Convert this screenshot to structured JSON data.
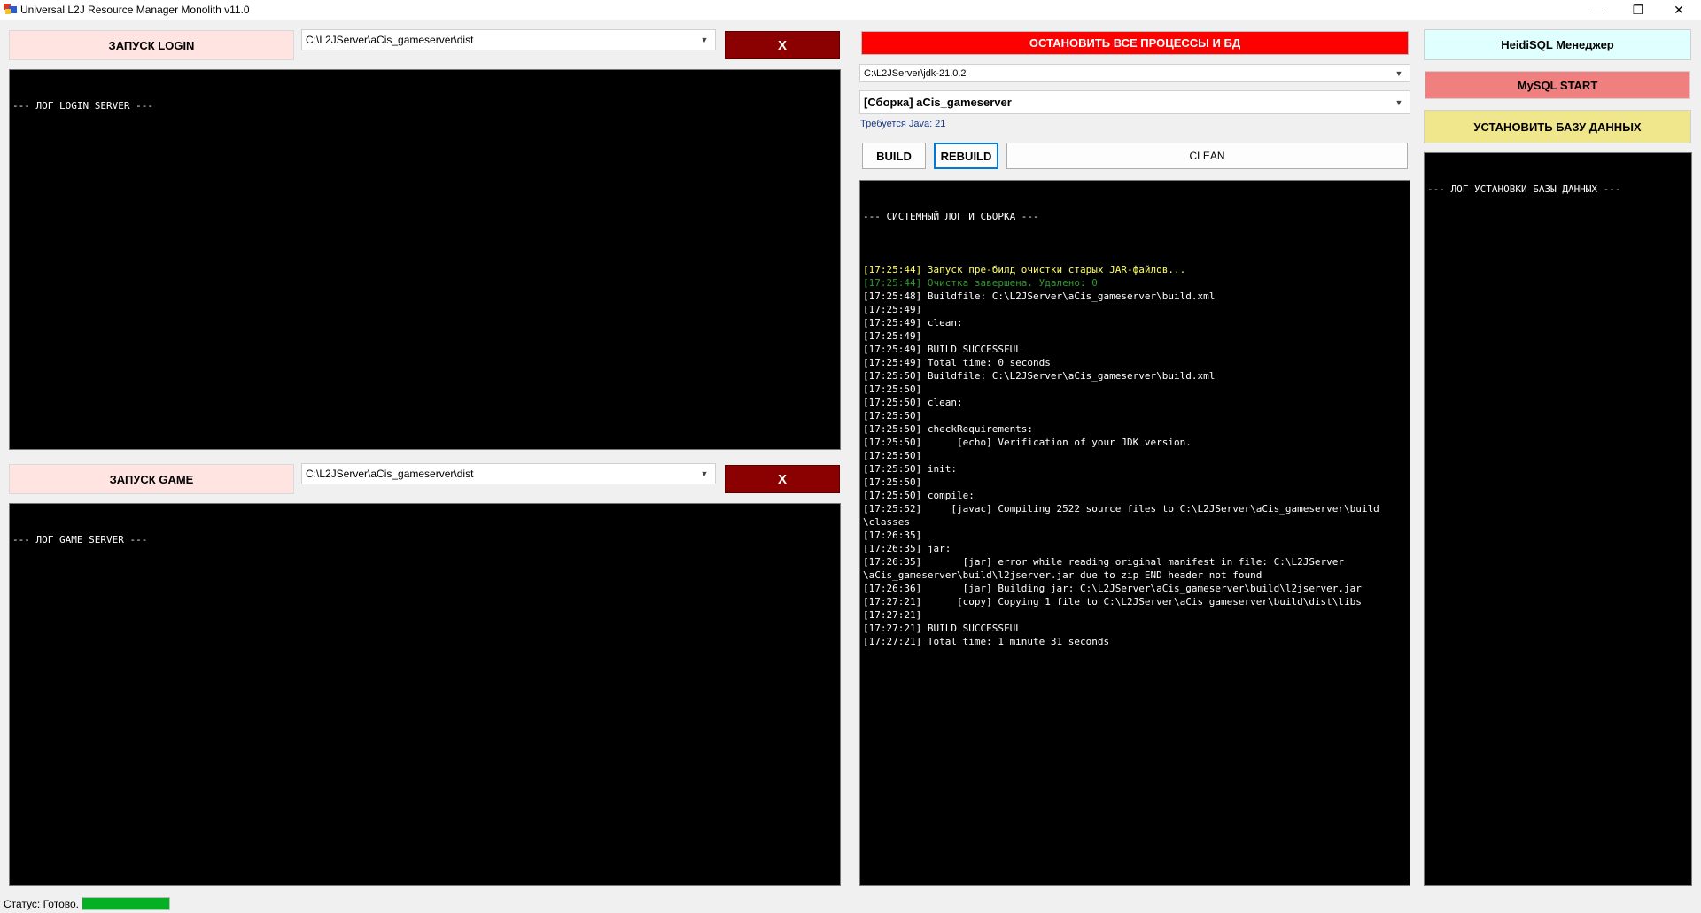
{
  "window": {
    "title": "Universal L2J Resource Manager Monolith v11.0",
    "controls": {
      "minimize": "—",
      "restore": "❐",
      "close": "✕"
    }
  },
  "login": {
    "start_label": "ЗАПУСК LOGIN",
    "path": "C:\\L2JServer\\aCis_gameserver\\dist",
    "stop_label": "X",
    "log_header": "--- ЛОГ LOGIN SERVER ---"
  },
  "game": {
    "start_label": "ЗАПУСК GAME",
    "path": "C:\\L2JServer\\aCis_gameserver\\dist",
    "stop_label": "X",
    "log_header": "--- ЛОГ GAME SERVER ---"
  },
  "build": {
    "stop_all_label": "ОСТАНОВИТЬ ВСЕ ПРОЦЕССЫ И БД",
    "jdk_path": "C:\\L2JServer\\jdk-21.0.2",
    "assembly": "[Сборка] aCis_gameserver",
    "java_required": "Требуется Java: 21",
    "build_label": "BUILD",
    "rebuild_label": "REBUILD",
    "clean_label": "CLEAN",
    "log_header": "--- СИСТЕМНЫЙ ЛОГ И СБОРКА ---",
    "log_lines": [
      {
        "text": "",
        "tone": "white"
      },
      {
        "text": "[17:25:44] Запуск пре-билд очистки старых JAR-файлов...",
        "tone": "yellow"
      },
      {
        "text": "[17:25:44] Очистка завершена. Удалено: 0",
        "tone": "green"
      },
      {
        "text": "[17:25:48] Buildfile: C:\\L2JServer\\aCis_gameserver\\build.xml",
        "tone": "white"
      },
      {
        "text": "[17:25:49]",
        "tone": "white"
      },
      {
        "text": "[17:25:49] clean:",
        "tone": "white"
      },
      {
        "text": "[17:25:49]",
        "tone": "white"
      },
      {
        "text": "[17:25:49] BUILD SUCCESSFUL",
        "tone": "white"
      },
      {
        "text": "[17:25:49] Total time: 0 seconds",
        "tone": "white"
      },
      {
        "text": "[17:25:50] Buildfile: C:\\L2JServer\\aCis_gameserver\\build.xml",
        "tone": "white"
      },
      {
        "text": "[17:25:50]",
        "tone": "white"
      },
      {
        "text": "[17:25:50] clean:",
        "tone": "white"
      },
      {
        "text": "[17:25:50]",
        "tone": "white"
      },
      {
        "text": "[17:25:50] checkRequirements:",
        "tone": "white"
      },
      {
        "text": "[17:25:50]      [echo] Verification of your JDK version.",
        "tone": "white"
      },
      {
        "text": "[17:25:50]",
        "tone": "white"
      },
      {
        "text": "[17:25:50] init:",
        "tone": "white"
      },
      {
        "text": "[17:25:50]",
        "tone": "white"
      },
      {
        "text": "[17:25:50] compile:",
        "tone": "white"
      },
      {
        "text": "[17:25:52]     [javac] Compiling 2522 source files to C:\\L2JServer\\aCis_gameserver\\build",
        "tone": "white"
      },
      {
        "text": "\\classes",
        "tone": "white"
      },
      {
        "text": "[17:26:35]",
        "tone": "white"
      },
      {
        "text": "[17:26:35] jar:",
        "tone": "white"
      },
      {
        "text": "[17:26:35]       [jar] error while reading original manifest in file: C:\\L2JServer",
        "tone": "white"
      },
      {
        "text": "\\aCis_gameserver\\build\\l2jserver.jar due to zip END header not found",
        "tone": "white"
      },
      {
        "text": "[17:26:36]       [jar] Building jar: C:\\L2JServer\\aCis_gameserver\\build\\l2jserver.jar",
        "tone": "white"
      },
      {
        "text": "[17:27:21]      [copy] Copying 1 file to C:\\L2JServer\\aCis_gameserver\\build\\dist\\libs",
        "tone": "white"
      },
      {
        "text": "[17:27:21]",
        "tone": "white"
      },
      {
        "text": "[17:27:21] BUILD SUCCESSFUL",
        "tone": "white"
      },
      {
        "text": "[17:27:21] Total time: 1 minute 31 seconds",
        "tone": "white"
      }
    ]
  },
  "database": {
    "heidisql_label": "HeidiSQL Менеджер",
    "mysql_label": "MySQL START",
    "install_label": "УСТАНОВИТЬ БАЗУ ДАННЫХ",
    "log_header": "--- ЛОГ УСТАНОВКИ БАЗЫ ДАННЫХ ---"
  },
  "status": {
    "text": "Статус: Готово.",
    "progress": 1.0
  },
  "colors": {
    "stop_all": "#ff0000",
    "stop_x": "#8b0000",
    "start_pink": "#ffe4e1",
    "heidisql": "#e0ffff",
    "mysql": "#f08080",
    "install_db": "#f0e68c",
    "progress": "#06b025"
  }
}
